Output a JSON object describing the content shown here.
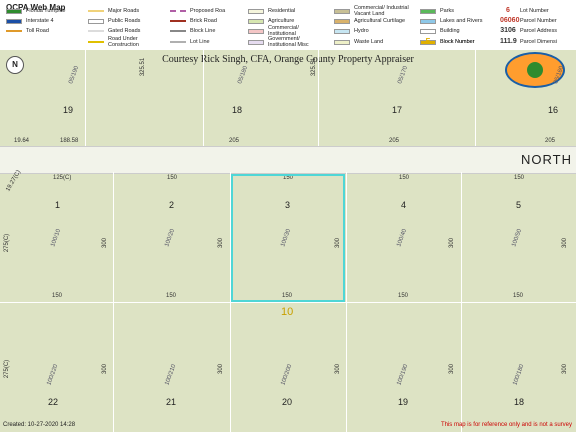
{
  "legend": {
    "title": "OCPA Web Map",
    "items": [
      {
        "id": "turnpike",
        "label": "Florida Turnpike",
        "color": "#2e8b2e"
      },
      {
        "id": "interstate",
        "label": "Interstate 4",
        "color": "#1a4fa6"
      },
      {
        "id": "toll",
        "label": "Toll Road",
        "color": "#e09a2a"
      },
      {
        "id": "major",
        "label": "Major Roads",
        "color": "#f0d27a"
      },
      {
        "id": "public",
        "label": "Public Roads",
        "color": "#ffffff"
      },
      {
        "id": "gated",
        "label": "Gated Roads",
        "color": "#dcdcdc"
      },
      {
        "id": "construction",
        "label": "Road Under Construction",
        "color": "#e0c000"
      },
      {
        "id": "proposed",
        "label": "Proposed Roa",
        "color": "#b05fa6"
      },
      {
        "id": "brick",
        "label": "Brick Road",
        "color": "#a03020"
      },
      {
        "id": "blockline",
        "label": "Block Line",
        "color": "#888888"
      },
      {
        "id": "lotline",
        "label": "Lot Line",
        "color": "#b0b0b0"
      },
      {
        "id": "residential",
        "label": "Residential",
        "color": "#f5f5dc"
      },
      {
        "id": "agriculture",
        "label": "Agriculture",
        "color": "#d6e6b0"
      },
      {
        "id": "commercial",
        "label": "Commercial/ Institutional",
        "color": "#f4c6c6"
      },
      {
        "id": "govt",
        "label": "Government/ Institutional Misc",
        "color": "#e6dcf0"
      },
      {
        "id": "industrial",
        "label": "Commercial/ Industrial Vacant Land",
        "color": "#c8c096"
      },
      {
        "id": "curtilage",
        "label": "Agricultural Curtilage",
        "color": "#d9b26b"
      },
      {
        "id": "hydro",
        "label": "Hydro",
        "color": "#c7e6f2"
      },
      {
        "id": "waste",
        "label": "Waste Land",
        "color": "#eef0c8"
      },
      {
        "id": "parks",
        "label": "Parks",
        "color": "#5ab85a"
      },
      {
        "id": "lakes",
        "label": "Lakes and Rivers",
        "color": "#8ec8e8"
      },
      {
        "id": "building",
        "label": "Building",
        "color": "#ffffff"
      },
      {
        "id": "blocknum",
        "label": "Block Number",
        "color": "#e0b000"
      }
    ],
    "symbols": [
      {
        "sym": "6",
        "label": "Lot Number",
        "color": "#c0392b"
      },
      {
        "sym": "06060",
        "label": "Parcel Number",
        "color": "#c0392b"
      },
      {
        "sym": "3106",
        "label": "Parcel Address",
        "color": "#333333"
      },
      {
        "sym": "111.9",
        "label": "Parcel Dimensi",
        "color": "#333333"
      },
      {
        "sym": "E",
        "label": "Block Number",
        "color": "#e0b000"
      }
    ]
  },
  "map": {
    "courtesy": "Courtesy Rick Singh, CFA, Orange County Property Appraiser",
    "north_arrow": "N",
    "road_name": "NORTH",
    "block": "10",
    "highlighted_lot": "3",
    "top_row": [
      {
        "lot": "19",
        "pid": "05/190",
        "dim_bottom": "188.58",
        "dim_side": "325.51"
      },
      {
        "lot": "18",
        "pid": "05/180",
        "dim_bottom": "205",
        "dim_side": "325.51"
      },
      {
        "lot": "17",
        "pid": "05/170",
        "dim_bottom": "205"
      },
      {
        "lot": "16",
        "pid": "05/160",
        "dim_bottom": "205"
      }
    ],
    "top_left_dim": "19.64",
    "middle_row": [
      {
        "lot": "1",
        "pid": "100/10",
        "dim_top": "125(C)",
        "dim_bottom": "150"
      },
      {
        "lot": "2",
        "pid": "100/20",
        "dim_top": "150",
        "dim_bottom": "150"
      },
      {
        "lot": "3",
        "pid": "100/30",
        "dim_top": "150",
        "dim_bottom": "150"
      },
      {
        "lot": "4",
        "pid": "100/40",
        "dim_top": "150",
        "dim_bottom": "150"
      },
      {
        "lot": "5",
        "pid": "100/50",
        "dim_top": "150",
        "dim_bottom": "150"
      }
    ],
    "middle_side_dim": "300",
    "left_curve_dim": "19.27(C)",
    "left_side_dim": "275(C)",
    "bottom_row": [
      {
        "lot": "22",
        "pid": "100/220"
      },
      {
        "lot": "21",
        "pid": "100/210"
      },
      {
        "lot": "20",
        "pid": "100/200"
      },
      {
        "lot": "19",
        "pid": "100/190"
      },
      {
        "lot": "18",
        "pid": "100/180"
      }
    ],
    "bottom_side_dim": "300"
  },
  "footer": {
    "created": "Created: 10-27-2020 14:28",
    "disclaimer": "This map is for reference only and is not a survey"
  }
}
